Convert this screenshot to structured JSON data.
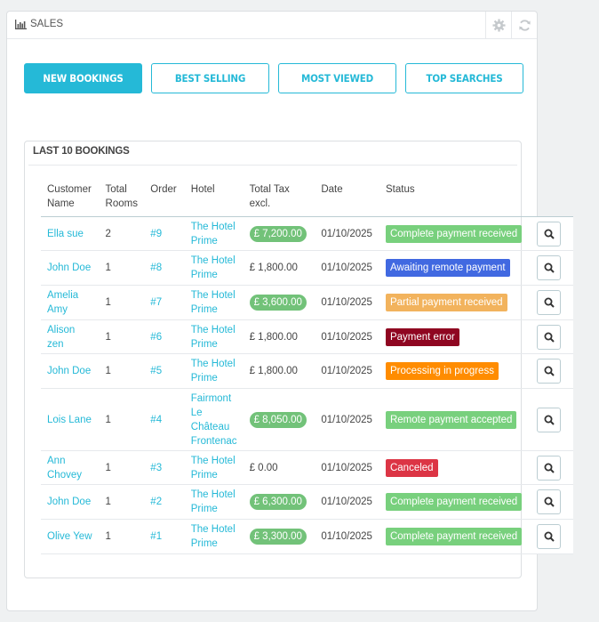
{
  "panel": {
    "title": "SALES",
    "icons": [
      "bar-chart-icon",
      "gear-icon",
      "refresh-icon"
    ]
  },
  "tabs": [
    {
      "label": "NEW BOOKINGS",
      "active": true
    },
    {
      "label": "BEST SELLING",
      "active": false
    },
    {
      "label": "MOST VIEWED",
      "active": false
    },
    {
      "label": "TOP SEARCHES",
      "active": false
    }
  ],
  "bookings": {
    "title": "LAST 10 BOOKINGS",
    "columns": [
      "Customer Name",
      "Total Rooms",
      "Order",
      "Hotel",
      "Total Tax excl.",
      "Date",
      "Status"
    ],
    "rows": [
      {
        "customer": "Ella sue",
        "rooms": "2",
        "order": "#9",
        "hotel": "The Hotel Prime",
        "total": "£ 7,200.00",
        "total_badge": true,
        "date": "01/10/2025",
        "status": "Complete payment received",
        "status_color": "#78d07d"
      },
      {
        "customer": "John Doe",
        "rooms": "1",
        "order": "#8",
        "hotel": "The Hotel Prime",
        "total": "£ 1,800.00",
        "total_badge": false,
        "date": "01/10/2025",
        "status": "Awaiting remote payment",
        "status_color": "#4169e1"
      },
      {
        "customer": "Amelia Amy",
        "rooms": "1",
        "order": "#7",
        "hotel": "The Hotel Prime",
        "total": "£ 3,600.00",
        "total_badge": true,
        "date": "01/10/2025",
        "status": "Partial payment received",
        "status_color": "#f2b35d"
      },
      {
        "customer": "Alison zen",
        "rooms": "1",
        "order": "#6",
        "hotel": "The Hotel Prime",
        "total": "£ 1,800.00",
        "total_badge": false,
        "date": "01/10/2025",
        "status": "Payment error",
        "status_color": "#8f0621"
      },
      {
        "customer": "John Doe",
        "rooms": "1",
        "order": "#5",
        "hotel": "The Hotel Prime",
        "total": "£ 1,800.00",
        "total_badge": false,
        "date": "01/10/2025",
        "status": "Processing in progress",
        "status_color": "#ff8c00"
      },
      {
        "customer": "Lois Lane",
        "rooms": "1",
        "order": "#4",
        "hotel": "Fairmont Le Château Frontenac",
        "total": "£ 8,050.00",
        "total_badge": true,
        "date": "01/10/2025",
        "status": "Remote payment accepted",
        "status_color": "#78d07d"
      },
      {
        "customer": "Ann Chovey",
        "rooms": "1",
        "order": "#3",
        "hotel": "The Hotel Prime",
        "total": "£ 0.00",
        "total_badge": false,
        "date": "01/10/2025",
        "status": "Canceled",
        "status_color": "#dc3545"
      },
      {
        "customer": "John Doe",
        "rooms": "1",
        "order": "#2",
        "hotel": "The Hotel Prime",
        "total": "£ 6,300.00",
        "total_badge": true,
        "date": "01/10/2025",
        "status": "Complete payment received",
        "status_color": "#78d07d"
      },
      {
        "customer": "Olive Yew",
        "rooms": "1",
        "order": "#1",
        "hotel": "The Hotel Prime",
        "total": "£ 3,300.00",
        "total_badge": true,
        "date": "01/10/2025",
        "status": "Complete payment received",
        "status_color": "#78d07d"
      }
    ]
  }
}
